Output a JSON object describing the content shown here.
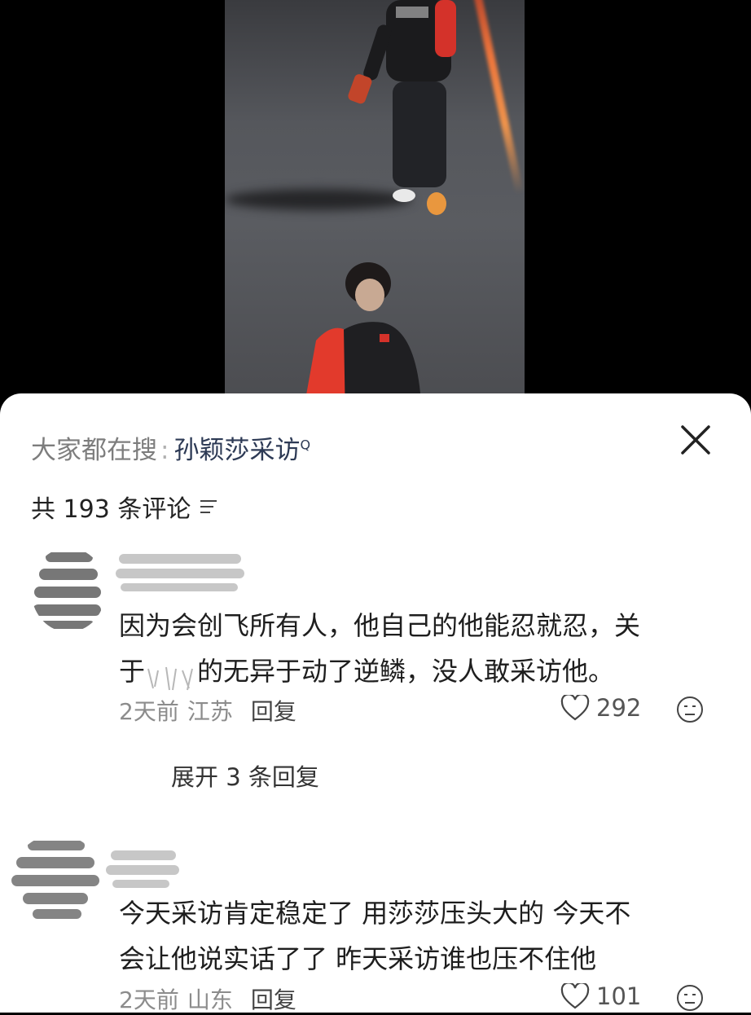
{
  "search": {
    "prefix": "大家都在搜",
    "separator": ":",
    "keyword": "孙颖莎采访",
    "search_glyph": "Q"
  },
  "comments_header": {
    "count_label": "共 193 条评论",
    "sort_icon": "sort-lines-icon"
  },
  "comments": [
    {
      "text_line1": "因为会创飞所有人，他自己的他能忍就忍，关",
      "text_line2_prefix": "于",
      "text_line2_redacted_glyphs": "莎莎",
      "text_line2_suffix": "的无异于动了逆鳞，没人敢采访他。",
      "time": "2天前",
      "location": "江苏",
      "reply_label": "回复",
      "likes": "292",
      "expand_label": "展开 3 条回复"
    },
    {
      "text_line1": "今天采访肯定稳定了 用莎莎压头大的 今天不",
      "text_line2": "会让他说实话了了 昨天采访谁也压不住他",
      "time": "2天前",
      "location": "山东",
      "reply_label": "回复",
      "likes": "101"
    }
  ],
  "colors": {
    "accent_keyword": "#2d3a55",
    "sheet_bg": "#ffffff",
    "muted_text": "#8c8c8c"
  }
}
